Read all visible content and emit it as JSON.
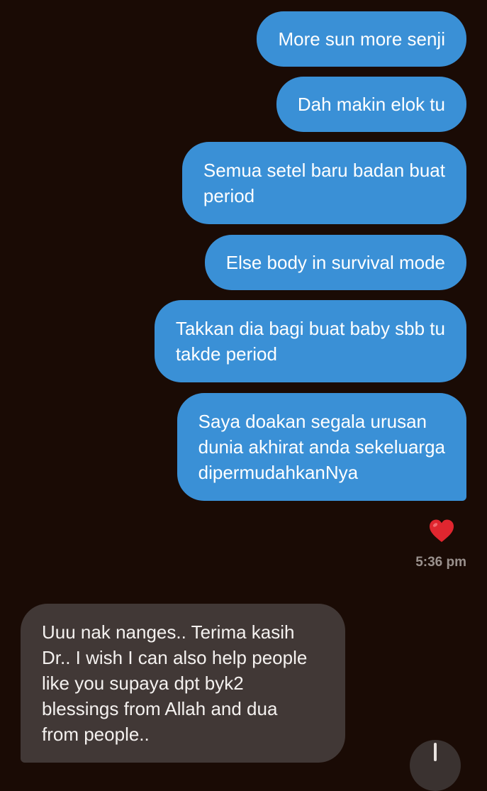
{
  "messages": [
    {
      "direction": "out",
      "text": "More sun more senji"
    },
    {
      "direction": "out",
      "text": "Dah makin elok tu"
    },
    {
      "direction": "out",
      "text": "Semua setel baru badan buat\nperiod"
    },
    {
      "direction": "out",
      "text": "Else body in survival mode"
    },
    {
      "direction": "out",
      "text": "Takkan dia bagi buat baby sbb tu\ntakde period"
    },
    {
      "direction": "out",
      "text": "Saya doakan segala urusan\ndunia akhirat anda sekeluarga\ndipermudahkanNya"
    },
    {
      "direction": "in",
      "text": "Uuu nak nanges.. Terima kasih\nDr.. I wish I can also help people\nlike you supaya dpt byk2\nblessings from Allah and dua\nfrom people.."
    }
  ],
  "reaction": {
    "icon": "red-heart-icon",
    "color": "#e0262f"
  },
  "timestamp": "5:36 pm",
  "scroll_button": {
    "icon": "arrow-down-icon"
  },
  "colors": {
    "background": "#1a0b05",
    "outgoing_bubble": "#3a90d6",
    "incoming_bubble": "#413836",
    "timestamp": "#9a918d"
  }
}
